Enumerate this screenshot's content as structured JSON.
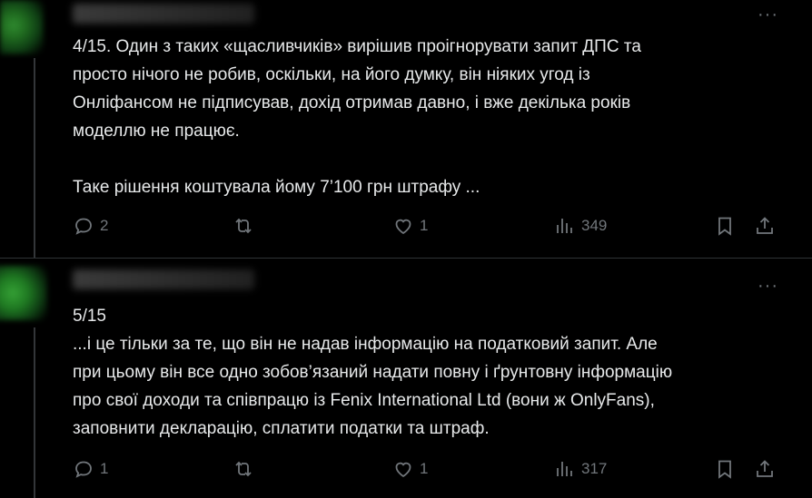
{
  "posts": [
    {
      "text": "4/15. Один з таких «щасливчиків» вирішив проігнорувати запит ДПС та\nпросто нічого не робив, оскільки, на його думку, він ніяких угод із\nОнліфансом не підписував, дохід отримав давно, і вже декілька років\nмоделлю не працює.\n\nТаке рішення коштувала йому 7’100 грн штрафу ...",
      "replies": "2",
      "reposts": "",
      "likes": "1",
      "views": "349"
    },
    {
      "text": "5/15\n...і це тільки за те, що він не надав інформацію на податковий запит. Але\nпри цьому він все одно зобов’язаний надати повну і ґрунтовну інформацію\nпро свої доходи та співпрацю із Fenix International Ltd (вони ж OnlyFans),\nзаповнити декларацію, сплатити податки та штраф.",
      "replies": "1",
      "reposts": "",
      "likes": "1",
      "views": "317"
    }
  ],
  "icons": {
    "reply": "reply-icon",
    "repost": "repost-icon",
    "like": "like-icon",
    "views": "views-icon",
    "bookmark": "bookmark-icon",
    "share": "share-icon",
    "more": "more-icon"
  },
  "colors": {
    "background": "#000000",
    "text": "#e7e9ea",
    "muted": "#71767b",
    "divider": "#2f3336"
  }
}
